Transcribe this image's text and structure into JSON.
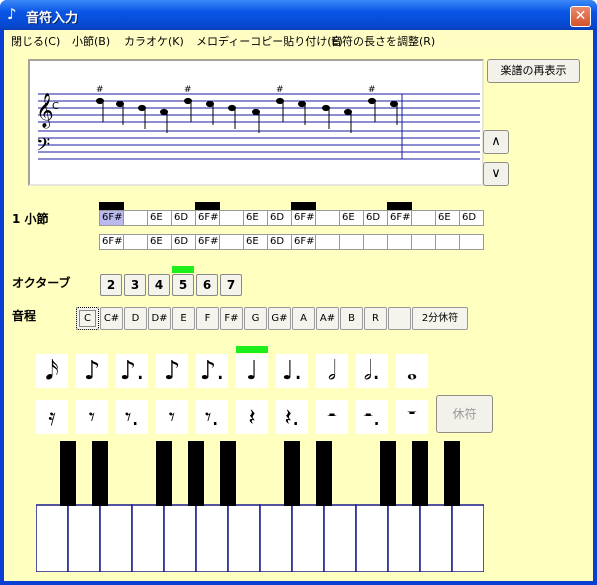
{
  "window": {
    "title": "音符入力",
    "icon": "music-note-icon",
    "close_label": "✕"
  },
  "menu": [
    "閉じる(C)",
    "小節(B)",
    "カラオケ(K)",
    "メロディーコピー貼り付け(E)",
    "音符の長さを調整(R)"
  ],
  "buttons": {
    "redisplay": "楽譜の再表示",
    "up": "∧",
    "down": "∨",
    "rest": "休符"
  },
  "labels": {
    "measure": "1 小節",
    "octave": "オクターブ",
    "pitch": "音程"
  },
  "measure": {
    "row1": [
      "6F#",
      "",
      "6E",
      "6D",
      "6F#",
      "",
      "6E",
      "6D",
      "6F#",
      "",
      "6E",
      "6D",
      "6F#",
      "",
      "6E",
      "6D"
    ],
    "row2": [
      "6F#",
      "",
      "6E",
      "6D",
      "6F#",
      "",
      "6E",
      "6D",
      "6F#",
      "",
      "",
      "",
      "",
      "",
      "",
      ""
    ],
    "beat_markers": [
      0,
      4,
      8,
      12
    ],
    "selected_index": 0
  },
  "octave": {
    "values": [
      "2",
      "3",
      "4",
      "5",
      "6",
      "7"
    ],
    "selected": "5"
  },
  "pitches": {
    "values": [
      "C",
      "C#",
      "D",
      "D#",
      "E",
      "F",
      "F#",
      "G",
      "G#",
      "A",
      "A#",
      "B",
      "R",
      "",
      "2分休符"
    ],
    "selected": "C"
  },
  "note_durations": {
    "items": [
      "sixteenth",
      "eighth",
      "dotted-eighth",
      "eighth-flag",
      "dotted-eighth-flag",
      "quarter",
      "dotted-quarter",
      "half",
      "dotted-half",
      "whole"
    ],
    "selected": "quarter"
  },
  "rest_durations": [
    "sixteenth-rest",
    "eighth-rest",
    "dotted-eighth-rest",
    "eighth-rest-single",
    "dotted-eighth-rest-single",
    "quarter-rest",
    "dotted-quarter-rest",
    "half-rest",
    "dotted-half-rest",
    "whole-rest"
  ],
  "colors": {
    "background": "#ffffc0",
    "selection": "#1bf01b",
    "staff_lines": "#1a1aa0"
  }
}
